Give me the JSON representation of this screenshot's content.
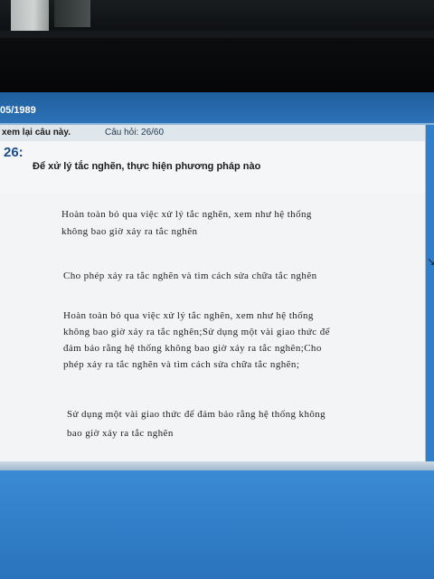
{
  "titlebar": {
    "date": "05/1989"
  },
  "infobar": {
    "review_label": "xem lại câu này.",
    "question_counter": "Câu hỏi: 26/60"
  },
  "question": {
    "number": "26:",
    "text": "Để xử lý tắc nghẽn, thực hiện phương pháp nào"
  },
  "options": [
    {
      "line1": "Hoàn toàn bỏ qua việc xử lý tắc nghẽn, xem như hệ thống",
      "line2": "không bao giờ xảy ra tắc nghẽn"
    },
    {
      "line1": "Cho phép xảy ra tắc nghẽn và tìm cách sửa chữa tắc nghẽn"
    },
    {
      "line1": "Hoàn toàn bỏ qua việc xử lý tắc nghẽn, xem như hệ thống",
      "line2": "không bao giờ xảy ra tắc nghẽn;Sử dụng một vài giao thức để",
      "line3": "đảm bảo rằng hệ thống không bao giờ xảy ra tắc nghẽn;Cho",
      "line4": "phép xảy ra tắc nghẽn và tìm cách sửa chữa tắc nghẽn;"
    },
    {
      "line1": "Sử dụng một vài giao thức để đảm bảo rằng hệ thống không",
      "line2": "bao giờ xảy ra tắc nghẽn"
    }
  ]
}
